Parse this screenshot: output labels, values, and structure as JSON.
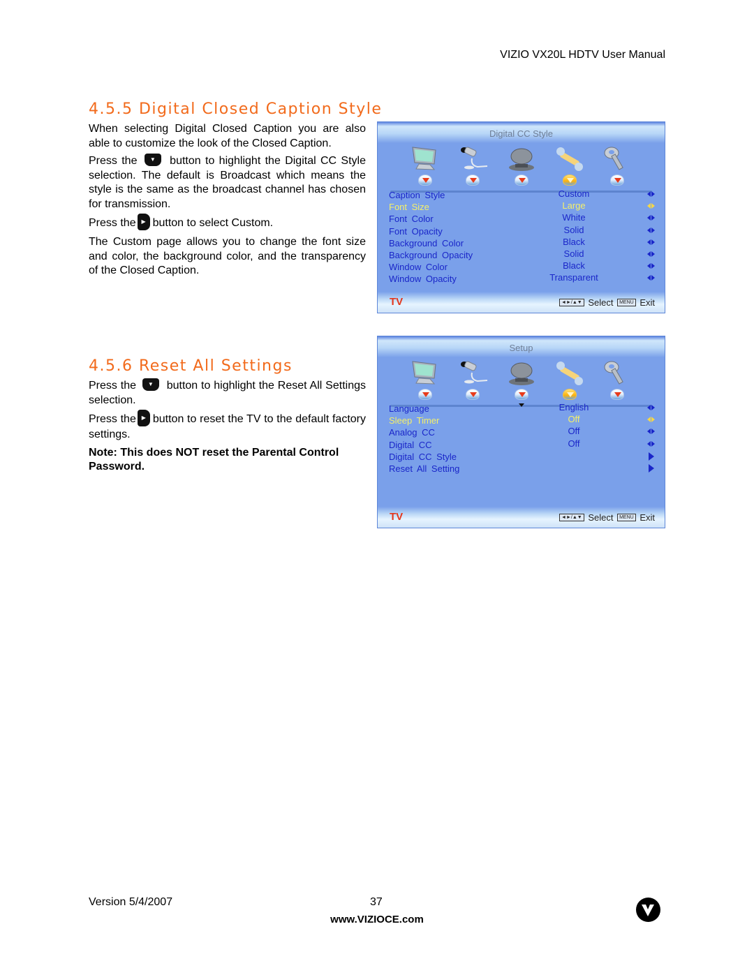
{
  "header": {
    "title": "VIZIO VX20L HDTV User Manual"
  },
  "sections": [
    {
      "heading": "4.5.5 Digital Closed Caption Style",
      "paragraphs": {
        "p1": "When selecting Digital Closed Caption you are also able to customize the look of the Closed Caption.",
        "p2_before": "Press the",
        "p2_after": "button to highlight the Digital CC Style selection.  The default is Broadcast which means the style is the same as the broadcast channel has chosen for transmission.",
        "p3_before": "Press the",
        "p3_after": "button to select Custom.",
        "p4": "The Custom page allows you to change the font size and color, the background color, and the transparency of the Closed Caption."
      },
      "osd": {
        "title": "Digital CC Style",
        "icons": [
          "tv-picture-icon",
          "audio-microphone-icon",
          "satellite-dish-icon",
          "wrench-setup-icon",
          "key-parental-icon"
        ],
        "active_icon_index": 3,
        "rows": [
          {
            "label": "Caption Style",
            "value": "Custom",
            "arrow": "left-right",
            "selected": false
          },
          {
            "label": "Font Size",
            "value": "Large",
            "arrow": "left-right",
            "selected": true
          },
          {
            "label": "Font Color",
            "value": "White",
            "arrow": "left-right",
            "selected": false
          },
          {
            "label": "Font Opacity",
            "value": "Solid",
            "arrow": "left-right",
            "selected": false
          },
          {
            "label": "Background Color",
            "value": "Black",
            "arrow": "left-right",
            "selected": false
          },
          {
            "label": "Background Opacity",
            "value": "Solid",
            "arrow": "left-right",
            "selected": false
          },
          {
            "label": "Window Color",
            "value": "Black",
            "arrow": "left-right",
            "selected": false
          },
          {
            "label": "Window Opacity",
            "value": "Transparent",
            "arrow": "left-right",
            "selected": false
          }
        ],
        "footer": {
          "source": "TV",
          "nav_key": "◄►/▲▼",
          "select_label": "Select",
          "menu_key": "MENU",
          "exit_label": "Exit"
        }
      }
    },
    {
      "heading": "4.5.6 Reset All Settings",
      "paragraphs": {
        "p1_before": "Press the",
        "p1_after": "button to highlight the Reset All Settings selection.",
        "p2_before": "Press the",
        "p2_after": "button to reset the TV to the default factory settings.",
        "note": "Note: This does NOT reset the Parental Control Password."
      },
      "osd": {
        "title": "Setup",
        "icons": [
          "tv-picture-icon",
          "audio-microphone-icon",
          "satellite-dish-icon",
          "wrench-setup-icon",
          "key-parental-icon"
        ],
        "active_icon_index": 3,
        "rows": [
          {
            "label": "Language",
            "value": "English",
            "arrow": "left-right",
            "selected": false
          },
          {
            "label": "Sleep Timer",
            "value": "Off",
            "arrow": "left-right",
            "selected": true
          },
          {
            "label": "Analog CC",
            "value": "Off",
            "arrow": "left-right",
            "selected": false
          },
          {
            "label": "Digital CC",
            "value": "Off",
            "arrow": "left-right",
            "selected": false
          },
          {
            "label": "Digital CC Style",
            "value": "",
            "arrow": "right",
            "selected": false
          },
          {
            "label": "Reset All Setting",
            "value": "",
            "arrow": "right",
            "selected": false
          }
        ],
        "footer": {
          "source": "TV",
          "nav_key": "◄►/▲▼",
          "select_label": "Select",
          "menu_key": "MENU",
          "exit_label": "Exit"
        }
      }
    }
  ],
  "buttons": {
    "down_glyph": "▼",
    "right_glyph": "▶"
  },
  "footer": {
    "version": "Version 5/4/2007",
    "page_number": "37",
    "url": "www.VIZIOCE.com",
    "logo": "vizio-v-logo"
  },
  "colors": {
    "heading": "#f26a1b",
    "osd_bg": "#7aa0ea",
    "menu_text": "#1a26c9",
    "menu_selected": "#f4f06a",
    "tv_label": "#e4371c"
  }
}
